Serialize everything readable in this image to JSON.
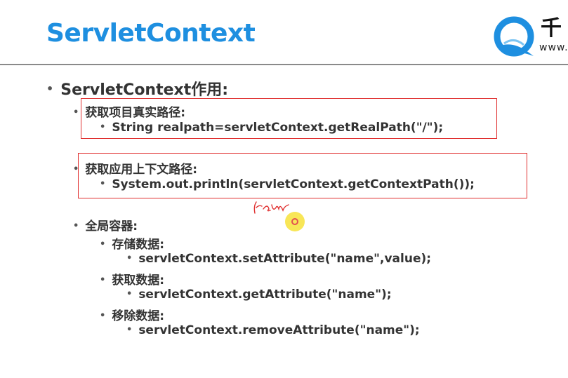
{
  "header": {
    "title": "ServletContext",
    "title_color": "#1e8fe0",
    "logo": {
      "icon": "q-logo-icon",
      "text": "千",
      "url": "www."
    }
  },
  "content": {
    "heading": "ServletContext作用:",
    "sections": [
      {
        "label": "获取项目真实路径:",
        "items": [
          "String realpath=servletContext.getRealPath(\"/\");"
        ]
      },
      {
        "label": "获取应用上下文路径:",
        "items": [
          "System.out.println(servletContext.getContextPath());"
        ]
      },
      {
        "label": "全局容器:",
        "subsections": [
          {
            "label": "存储数据:",
            "items": [
              "servletContext.setAttribute(\"name\",value);"
            ]
          },
          {
            "label": "获取数据:",
            "items": [
              "servletContext.getAttribute(\"name\");"
            ]
          },
          {
            "label": "移除数据:",
            "items": [
              "servletContext.removeAttribute(\"name\");"
            ]
          }
        ]
      }
    ]
  },
  "annotations": {
    "highlight_color": "#e03030",
    "cursor_color": "#f7e23a"
  }
}
